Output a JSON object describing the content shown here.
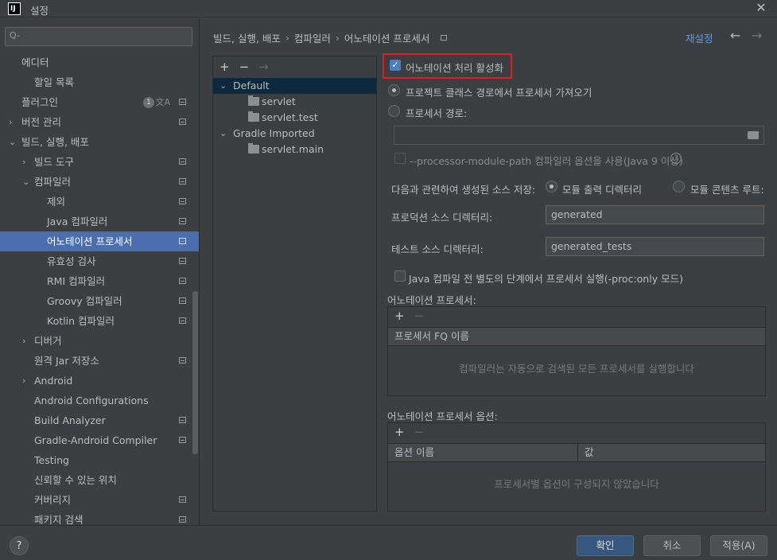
{
  "window": {
    "title": "설정",
    "app_logo": "IJ"
  },
  "sidebar": {
    "search_placeholder": "Q-",
    "items": [
      {
        "label": "에디터"
      },
      {
        "label": "할일 목록"
      },
      {
        "label": "플러그인",
        "badge": "1"
      },
      {
        "label": "버전 관리"
      },
      {
        "label": "빌드, 실행, 배포"
      },
      {
        "label": "빌드 도구"
      },
      {
        "label": "컴파일러"
      },
      {
        "label": "제외"
      },
      {
        "label": "Java 컴파일러"
      },
      {
        "label": "어노테이션 프로세서"
      },
      {
        "label": "유효성 검사"
      },
      {
        "label": "RMI 컴파일러"
      },
      {
        "label": "Groovy 컴파일러"
      },
      {
        "label": "Kotlin 컴파일러"
      },
      {
        "label": "디버거"
      },
      {
        "label": "원격 Jar 저장소"
      },
      {
        "label": "Android"
      },
      {
        "label": "Android Configurations"
      },
      {
        "label": "Build Analyzer"
      },
      {
        "label": "Gradle-Android Compiler"
      },
      {
        "label": "Testing"
      },
      {
        "label": "신뢰할 수 있는 위치"
      },
      {
        "label": "커버리지"
      },
      {
        "label": "패키지 검색"
      }
    ]
  },
  "header": {
    "breadcrumb": [
      "빌드, 실행, 배포",
      "컴파일러",
      "어노테이션 프로세서"
    ],
    "reset_label": "재설정"
  },
  "profiles": {
    "items": [
      {
        "label": "Default"
      },
      {
        "label": "servlet"
      },
      {
        "label": "servlet.test"
      },
      {
        "label": "Gradle Imported"
      },
      {
        "label": "servlet.main"
      }
    ]
  },
  "settings": {
    "enable_label": "어노테이션 처리 활성화",
    "enable_checked": true,
    "obtain_classpath_label": "프로젝트 클래스 경로에서 프로세서 가져오기",
    "processor_path_label": "프로세서 경로:",
    "processor_path_value": "",
    "module_path_label": "--processor-module-path 컴파일러 옵션을 사용(Java 9 이상)",
    "store_generated_label": "다음과 관련하여 생성된 소스 저장:",
    "module_output_label": "모듈 출력 디렉터리",
    "module_content_label": "모듈 콘텐츠 루트:",
    "production_dir_label": "프로덕션 소스 디렉터리:",
    "production_dir_value": "generated",
    "test_dir_label": "테스트 소스 디렉터리:",
    "test_dir_value": "generated_tests",
    "proc_only_label": "Java 컴파일 전 별도의 단계에서 프로세서 실행(-proc:only 모드)",
    "processors_section_label": "어노테이션 프로세서:",
    "processors_column": "프로세서 FQ 이름",
    "processors_empty": "컴파일러는 자동으로 검색된 모든 프로세서를 실행합니다",
    "options_section_label": "어노테이션 프로세서 옵션:",
    "options_columns": [
      "옵션 이름",
      "값"
    ],
    "options_empty": "프로세서별 옵션이 구성되지 않았습니다"
  },
  "footer": {
    "help_label": "?",
    "ok_label": "확인",
    "cancel_label": "취소",
    "apply_label": "적용(A)"
  },
  "colors": {
    "background": "#3c3f41",
    "selection": "#4b6eaf",
    "link": "#589df6",
    "highlight_border": "#e02020",
    "primary_button": "#365880"
  }
}
